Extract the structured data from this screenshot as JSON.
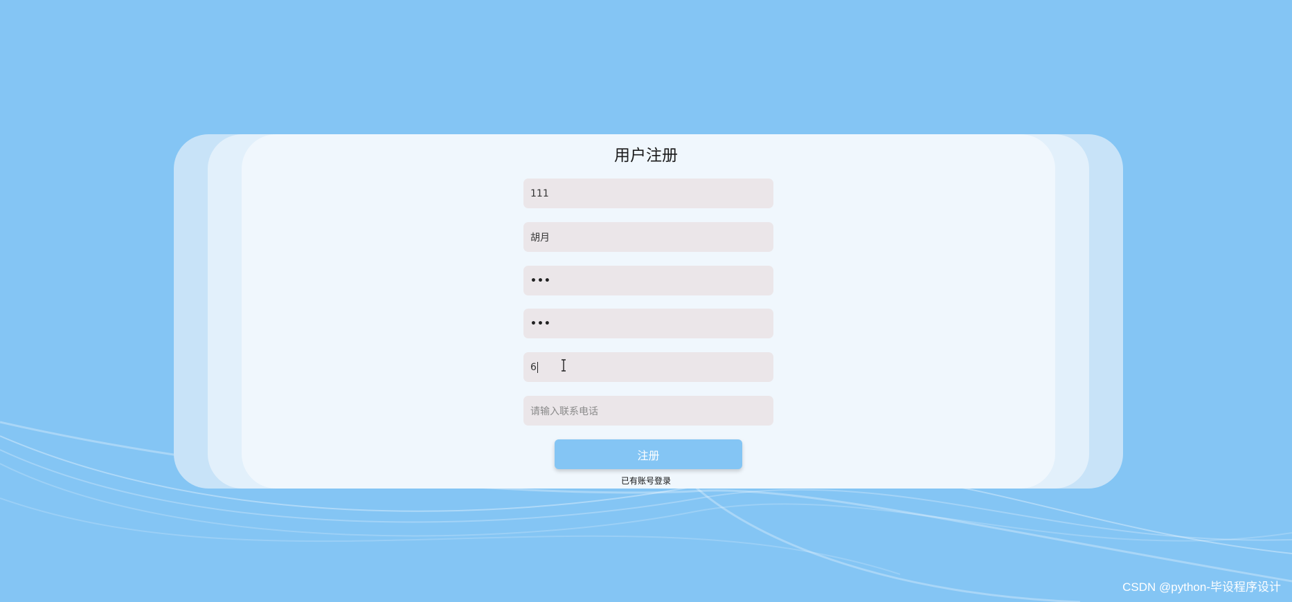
{
  "form": {
    "title": "用户注册",
    "fields": [
      {
        "name": "username",
        "value": "111",
        "placeholder": ""
      },
      {
        "name": "real-name",
        "value": "胡月",
        "placeholder": ""
      },
      {
        "name": "password",
        "value": "•••",
        "placeholder": ""
      },
      {
        "name": "confirm-password",
        "value": "•••",
        "placeholder": ""
      },
      {
        "name": "active-field",
        "value": "6",
        "placeholder": ""
      },
      {
        "name": "phone",
        "value": "",
        "placeholder": "请输入联系电话"
      }
    ],
    "submit_label": "注册",
    "login_link": "已有账号登录"
  },
  "watermark": "CSDN @python-毕设程序设计",
  "colors": {
    "background": "#84c5f4",
    "card": "#f0f7fd",
    "input": "#ebe6e9",
    "button": "#84c5f4"
  }
}
